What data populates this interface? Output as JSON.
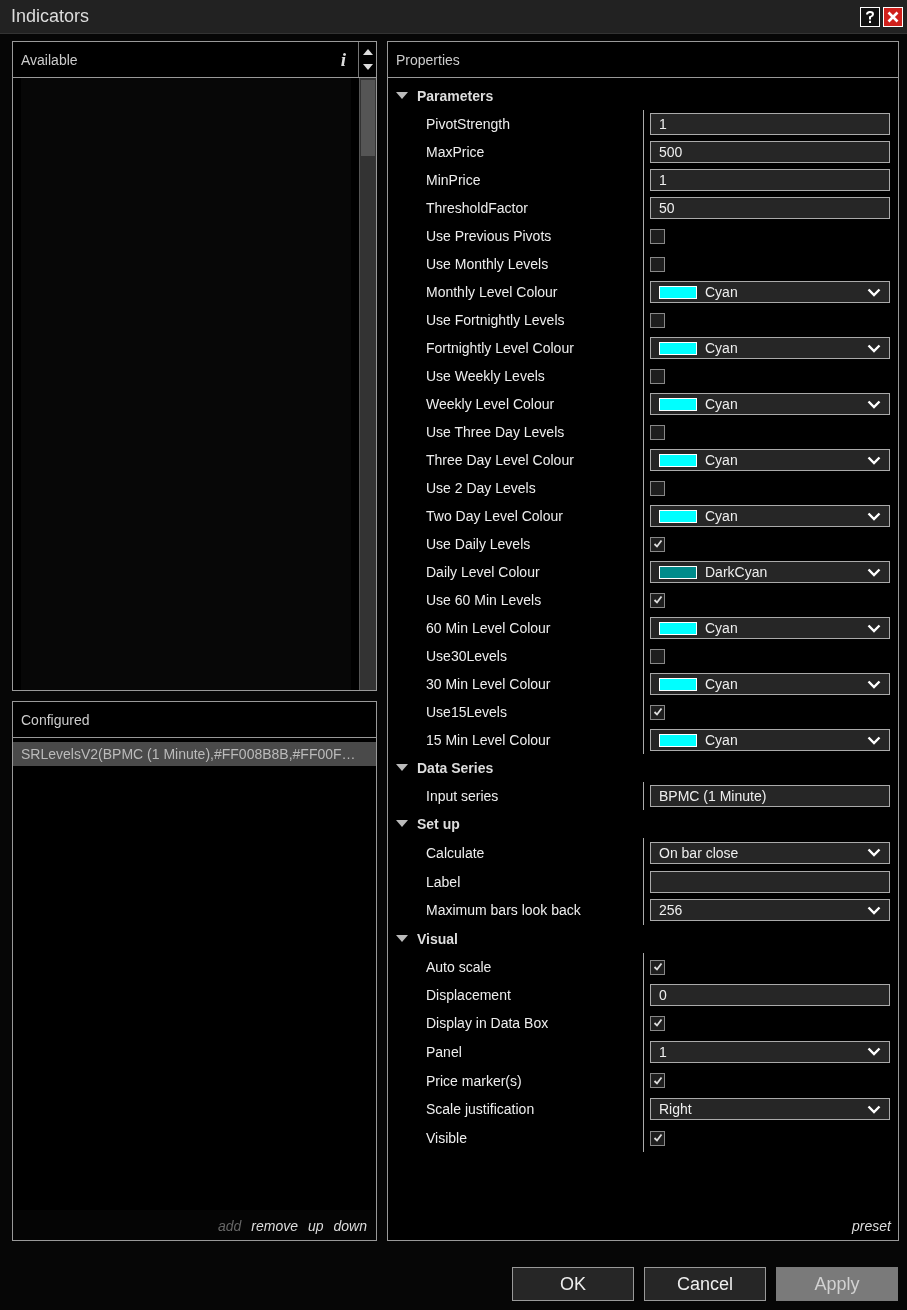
{
  "window": {
    "title": "Indicators"
  },
  "available": {
    "title": "Available",
    "info": "i"
  },
  "configured": {
    "title": "Configured",
    "items": [
      {
        "label": "SRLevelsV2(BPMC (1 Minute),#FF008B8B,#FF00F…",
        "selected": true
      }
    ],
    "actions": [
      {
        "label": "add",
        "disabled": true
      },
      {
        "label": "remove",
        "disabled": false
      },
      {
        "label": "up",
        "disabled": false
      },
      {
        "label": "down",
        "disabled": false
      }
    ]
  },
  "properties": {
    "title": "Properties",
    "preset": "preset",
    "sections": [
      {
        "title": "Parameters",
        "expanded": true,
        "rows": [
          {
            "label": "PivotStrength",
            "kind": "text",
            "value": "1"
          },
          {
            "label": "MaxPrice",
            "kind": "text",
            "value": "500"
          },
          {
            "label": "MinPrice",
            "kind": "text",
            "value": "1"
          },
          {
            "label": "ThresholdFactor",
            "kind": "text",
            "value": "50"
          },
          {
            "label": "Use Previous Pivots",
            "kind": "check",
            "checked": false
          },
          {
            "label": "Use Monthly Levels",
            "kind": "check",
            "checked": false
          },
          {
            "label": "Monthly Level Colour",
            "kind": "color",
            "value": "Cyan",
            "color": "#00ffff"
          },
          {
            "label": "Use Fortnightly Levels",
            "kind": "check",
            "checked": false
          },
          {
            "label": "Fortnightly Level Colour",
            "kind": "color",
            "value": "Cyan",
            "color": "#00ffff"
          },
          {
            "label": "Use Weekly Levels",
            "kind": "check",
            "checked": false
          },
          {
            "label": "Weekly Level Colour",
            "kind": "color",
            "value": "Cyan",
            "color": "#00ffff"
          },
          {
            "label": "Use Three Day Levels",
            "kind": "check",
            "checked": false
          },
          {
            "label": "Three Day Level Colour",
            "kind": "color",
            "value": "Cyan",
            "color": "#00ffff"
          },
          {
            "label": "Use 2 Day Levels",
            "kind": "check",
            "checked": false
          },
          {
            "label": "Two Day Level Colour",
            "kind": "color",
            "value": "Cyan",
            "color": "#00ffff"
          },
          {
            "label": "Use Daily Levels",
            "kind": "check",
            "checked": true
          },
          {
            "label": "Daily Level Colour",
            "kind": "color",
            "value": "DarkCyan",
            "color": "#008b8b"
          },
          {
            "label": "Use 60 Min Levels",
            "kind": "check",
            "checked": true
          },
          {
            "label": "60 Min Level Colour",
            "kind": "color",
            "value": "Cyan",
            "color": "#00ffff"
          },
          {
            "label": "Use30Levels",
            "kind": "check",
            "checked": false
          },
          {
            "label": "30 Min Level Colour",
            "kind": "color",
            "value": "Cyan",
            "color": "#00ffff"
          },
          {
            "label": "Use15Levels",
            "kind": "check",
            "checked": true
          },
          {
            "label": "15 Min Level Colour",
            "kind": "color",
            "value": "Cyan",
            "color": "#00ffff"
          }
        ]
      },
      {
        "title": "Data Series",
        "expanded": true,
        "rows": [
          {
            "label": "Input series",
            "kind": "text",
            "value": "BPMC (1 Minute)"
          }
        ]
      },
      {
        "title": "Set up",
        "expanded": true,
        "rows": [
          {
            "label": "Calculate",
            "kind": "select",
            "value": "On bar close"
          },
          {
            "label": "Label",
            "kind": "text"
          },
          {
            "label": "Maximum bars look back",
            "kind": "select",
            "value": "256"
          }
        ]
      },
      {
        "title": "Visual",
        "expanded": true,
        "rows": [
          {
            "label": "Auto scale",
            "kind": "check",
            "checked": true
          },
          {
            "label": "Displacement",
            "kind": "text",
            "value": "0"
          },
          {
            "label": "Display in Data Box",
            "kind": "check",
            "checked": true
          },
          {
            "label": "Panel",
            "kind": "select",
            "value": "1"
          },
          {
            "label": "Price marker(s)",
            "kind": "check",
            "checked": true
          },
          {
            "label": "Scale justification",
            "kind": "select",
            "value": "Right"
          },
          {
            "label": "Visible",
            "kind": "check",
            "checked": true
          }
        ]
      }
    ]
  },
  "buttons": [
    {
      "label": "OK",
      "disabled": false
    },
    {
      "label": "Cancel",
      "disabled": false
    },
    {
      "label": "Apply",
      "disabled": true
    }
  ]
}
